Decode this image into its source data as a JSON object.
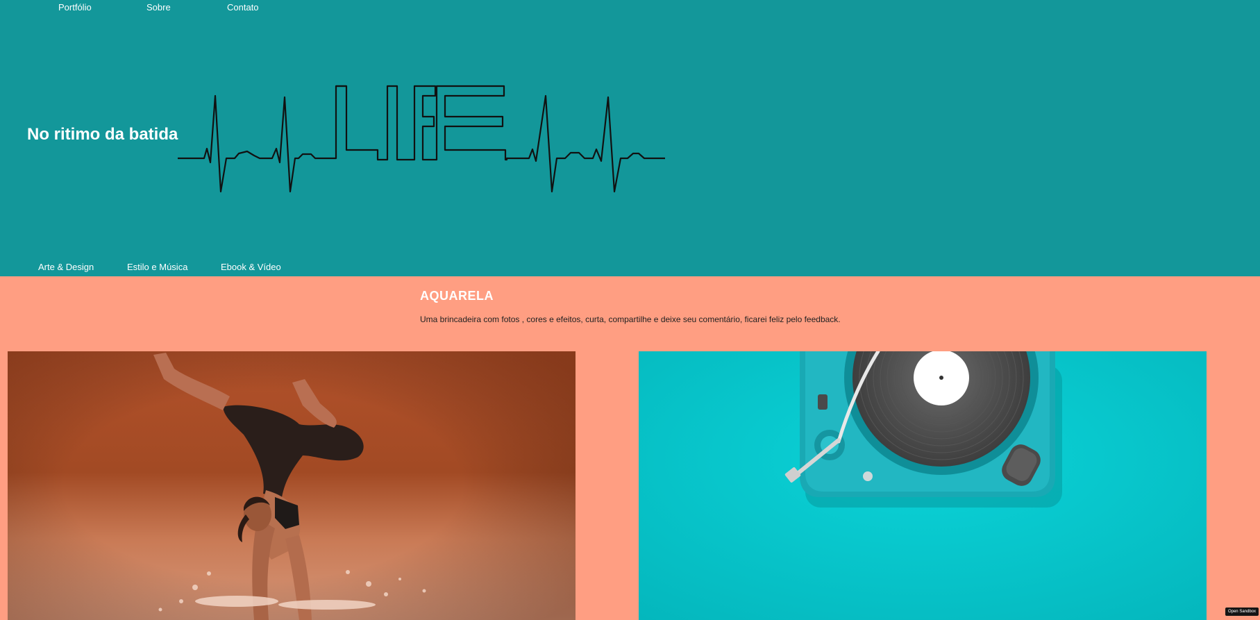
{
  "top_nav": [
    {
      "label": "Portfólio"
    },
    {
      "label": "Sobre"
    },
    {
      "label": "Contato"
    }
  ],
  "brand": {
    "title": "No ritimo da batida",
    "logo_text": "LIFE"
  },
  "category_nav": [
    {
      "label": "Arte & Design"
    },
    {
      "label": "Estilo e Música"
    },
    {
      "label": "Ebook & Vídeo"
    }
  ],
  "content": {
    "title": "AQUARELA",
    "description": "Uma brincadeira com fotos , cores e efeitos, curta, compartilhe e deixe seu comentário, ficarei feliz pelo feedback."
  },
  "gallery": {
    "images": [
      {
        "subject": "dancer-handstand-splash-photo"
      },
      {
        "subject": "turntable-record-player-photo"
      }
    ]
  },
  "sandbox_button": {
    "label": "Open Sandbox"
  },
  "colors": {
    "header_bg": "#13979a",
    "content_bg": "#ff9e82",
    "turntable_bg": "#05c6cc",
    "text_light": "#ffffff"
  }
}
